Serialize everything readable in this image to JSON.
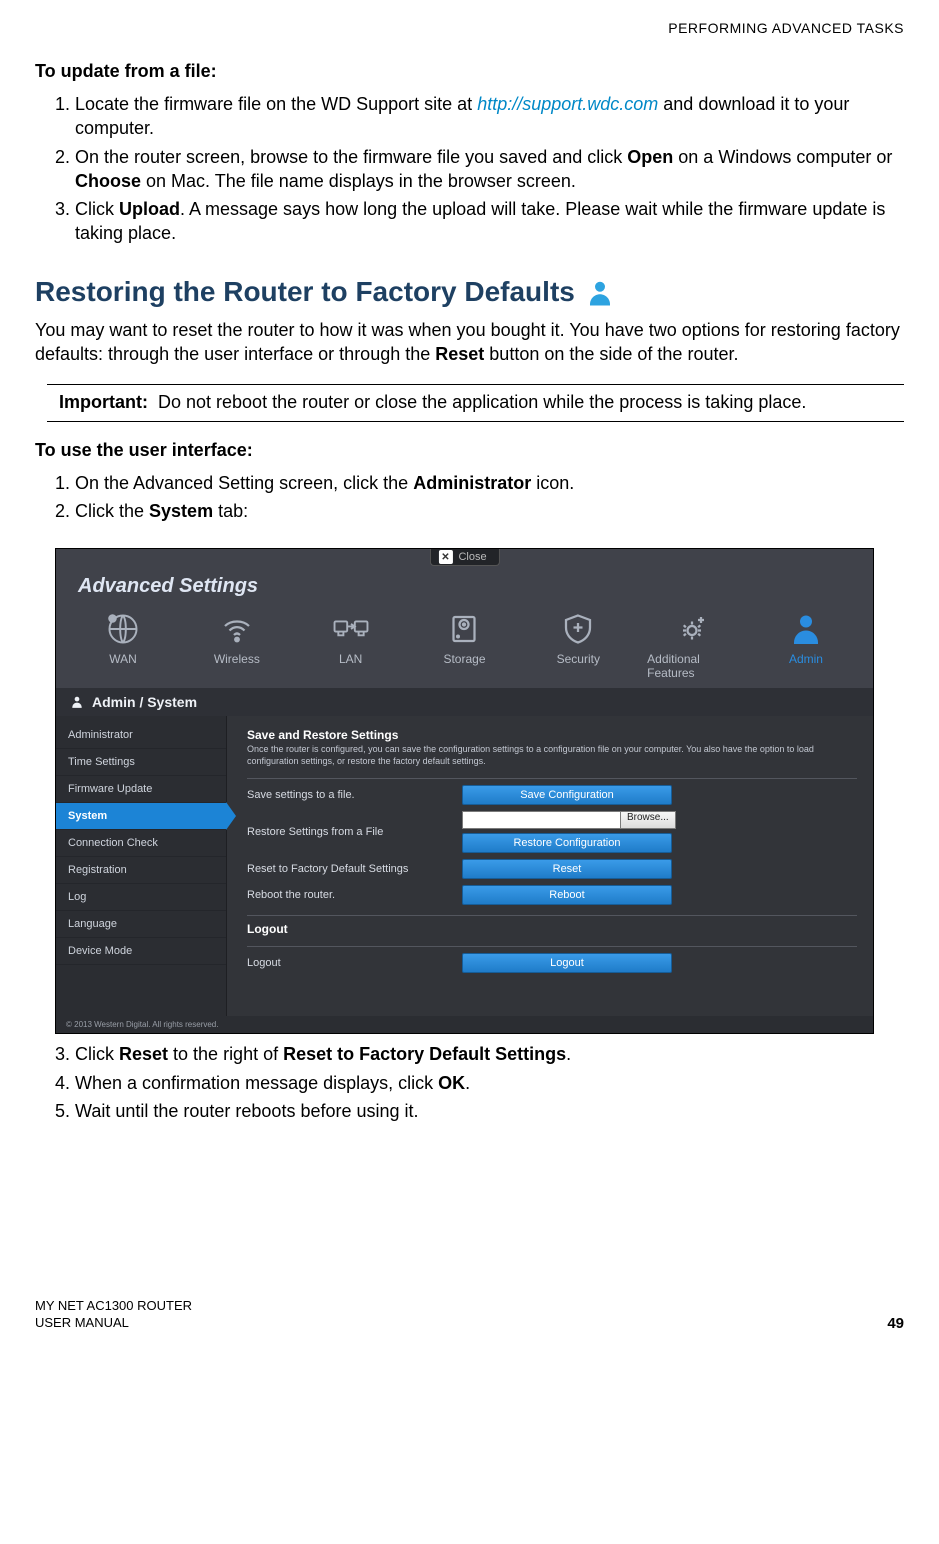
{
  "header": {
    "section_title": "PERFORMING ADVANCED TASKS"
  },
  "section1": {
    "heading": "To update from a file:",
    "steps": {
      "s1_a": "Locate the firmware file on the WD Support site at ",
      "s1_link": "http://support.wdc.com",
      "s1_b": " and download it to your computer.",
      "s2_a": "On the router screen, browse to the firmware file you saved and click ",
      "s2_b": "Open",
      "s2_c": " on a Windows computer or ",
      "s2_d": "Choose",
      "s2_e": " on Mac. The file name displays in the browser screen.",
      "s3_a": "Click ",
      "s3_b": "Upload",
      "s3_c": ". A message says how long the upload will take. Please wait while the firmware update is taking place."
    }
  },
  "section2": {
    "heading": "Restoring the Router to Factory Defaults",
    "intro_a": "You may want to reset the router to how it was when you bought it. You have two options for restoring factory defaults: through the user interface or through the ",
    "intro_b": "Reset",
    "intro_c": " button on the side of the router.",
    "important_label": "Important:",
    "important_text": "Do not reboot the router or close the application while the process is taking place.",
    "sub_heading": "To use the user interface:",
    "steps_pre": {
      "s1_a": "On the Advanced Setting screen, click the ",
      "s1_b": "Administrator",
      "s1_c": " icon.",
      "s2_a": "Click the ",
      "s2_b": "System",
      "s2_c": " tab:"
    },
    "steps_post": {
      "s3_a": "Click ",
      "s3_b": "Reset",
      "s3_c": " to the right of ",
      "s3_d": "Reset to Factory Default Settings",
      "s3_e": ".",
      "s4_a": "When a confirmation message displays, click ",
      "s4_b": "OK",
      "s4_c": ".",
      "s5": "Wait until the router reboots before using it."
    }
  },
  "screenshot": {
    "close_label": "Close",
    "title": "Advanced Settings",
    "nav": [
      "WAN",
      "Wireless",
      "LAN",
      "Storage",
      "Security",
      "Additional Features",
      "Admin"
    ],
    "breadcrumb": "Admin / System",
    "sidebar": [
      "Administrator",
      "Time Settings",
      "Firmware Update",
      "System",
      "Connection Check",
      "Registration",
      "Log",
      "Language",
      "Device Mode"
    ],
    "main": {
      "sec1_title": "Save and Restore Settings",
      "sec1_desc": "Once the router is configured, you can save the configuration settings to a configuration file on your computer. You also have the option to load configuration settings, or restore the factory default settings.",
      "row1_label": "Save settings to a file.",
      "row1_btn": "Save Configuration",
      "row2_label": "Restore Settings from a File",
      "row2_browse": "Browse...",
      "row2_btn": "Restore Configuration",
      "row3_label": "Reset to Factory Default Settings",
      "row3_btn": "Reset",
      "row4_label": "Reboot the router.",
      "row4_btn": "Reboot",
      "sec2_title": "Logout",
      "row5_label": "Logout",
      "row5_btn": "Logout"
    },
    "copyright": "© 2013 Western Digital. All rights reserved."
  },
  "footer": {
    "line1": "MY NET AC1300 ROUTER",
    "line2": "USER MANUAL",
    "page": "49"
  }
}
